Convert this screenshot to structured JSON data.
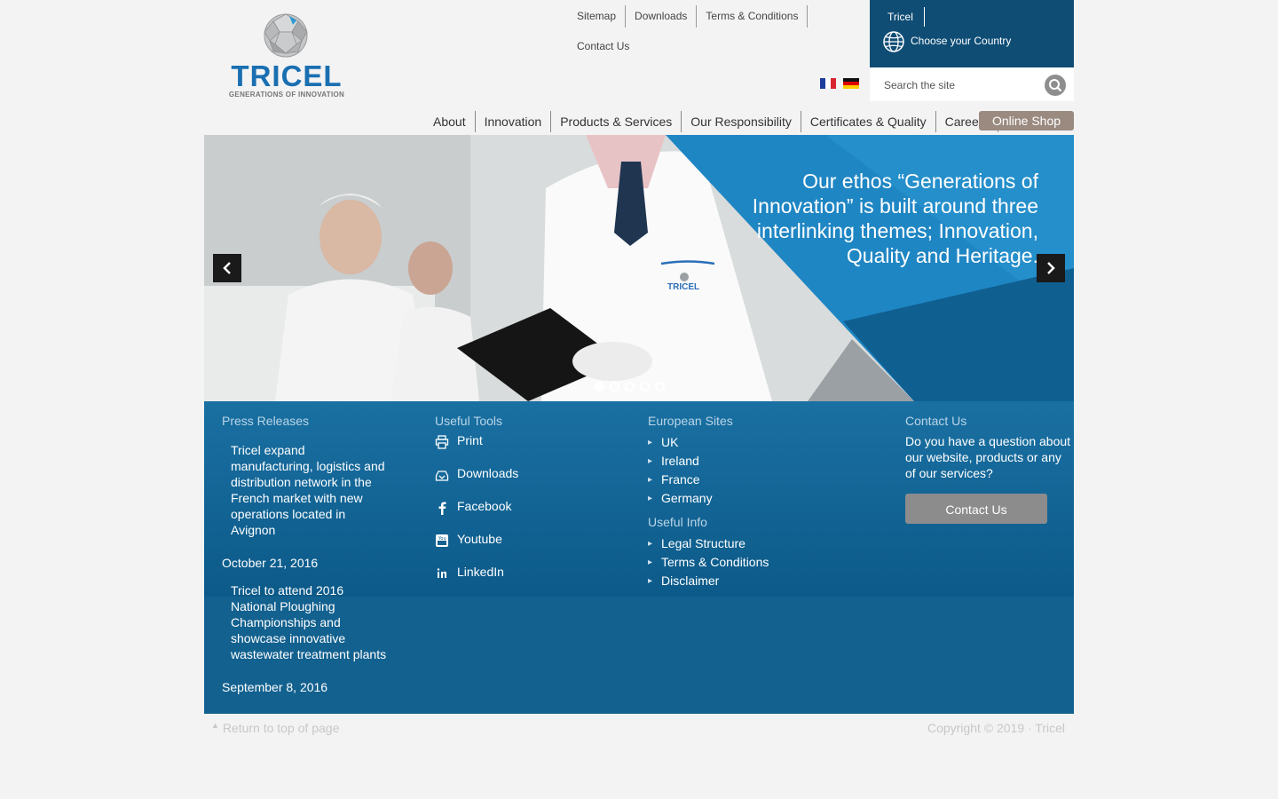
{
  "logo": {
    "wordmark": "TRICEL",
    "tagline": "GENERATIONS OF INNOVATION"
  },
  "top_links": [
    "Sitemap",
    "Downloads",
    "Terms & Conditions",
    "Contact Us"
  ],
  "country": {
    "tab": "Tricel",
    "choose": "Choose your Country"
  },
  "flags": [
    "flag-fr",
    "flag-de"
  ],
  "search": {
    "placeholder": "Search the site"
  },
  "nav": {
    "items": [
      "About",
      "Innovation",
      "Products & Services",
      "Our Responsibility",
      "Certificates & Quality",
      "Careers"
    ],
    "shop": "Online Shop"
  },
  "hero": {
    "text": "Our ethos “Generations of Innovation” is built around three interlinking themes; Innovation, Quality and Heritage.",
    "logo_on_coat": "TRICEL",
    "slides": 5,
    "active_slide": 1
  },
  "press": {
    "heading": "Press Releases",
    "items": [
      {
        "title": "Tricel expand manufacturing, logistics and distribution network in the French market with new operations located in Avignon",
        "date": "October 21, 2016"
      },
      {
        "title": "Tricel to attend 2016 National Ploughing Championships and showcase innovative wastewater treatment plants",
        "date": "September 8, 2016"
      }
    ]
  },
  "tools": {
    "heading": "Useful Tools",
    "items": [
      {
        "label": "Print",
        "icon": "print-icon"
      },
      {
        "label": "Downloads",
        "icon": "download-icon"
      },
      {
        "label": "Facebook",
        "icon": "facebook-icon"
      },
      {
        "label": "Youtube",
        "icon": "youtube-icon"
      },
      {
        "label": "LinkedIn",
        "icon": "linkedin-icon"
      }
    ]
  },
  "european_sites": {
    "heading": "European Sites",
    "items": [
      "UK",
      "Ireland",
      "France",
      "Germany"
    ]
  },
  "useful_info": {
    "heading": "Useful Info",
    "items": [
      "Legal Structure",
      "Terms & Conditions",
      "Disclaimer"
    ]
  },
  "contact": {
    "heading": "Contact Us",
    "text": "Do you have a question about our website, products or any of our services?",
    "button": "Contact Us"
  },
  "bottom": {
    "return_top": "Return to top of page",
    "copyright": "Copyright © 2019 · Tricel"
  },
  "colors": {
    "brand_blue": "#1a6fb1",
    "footer_blue": "#13618f",
    "country_bg": "#0f4d75",
    "shop_btn": "#9a8a80"
  }
}
